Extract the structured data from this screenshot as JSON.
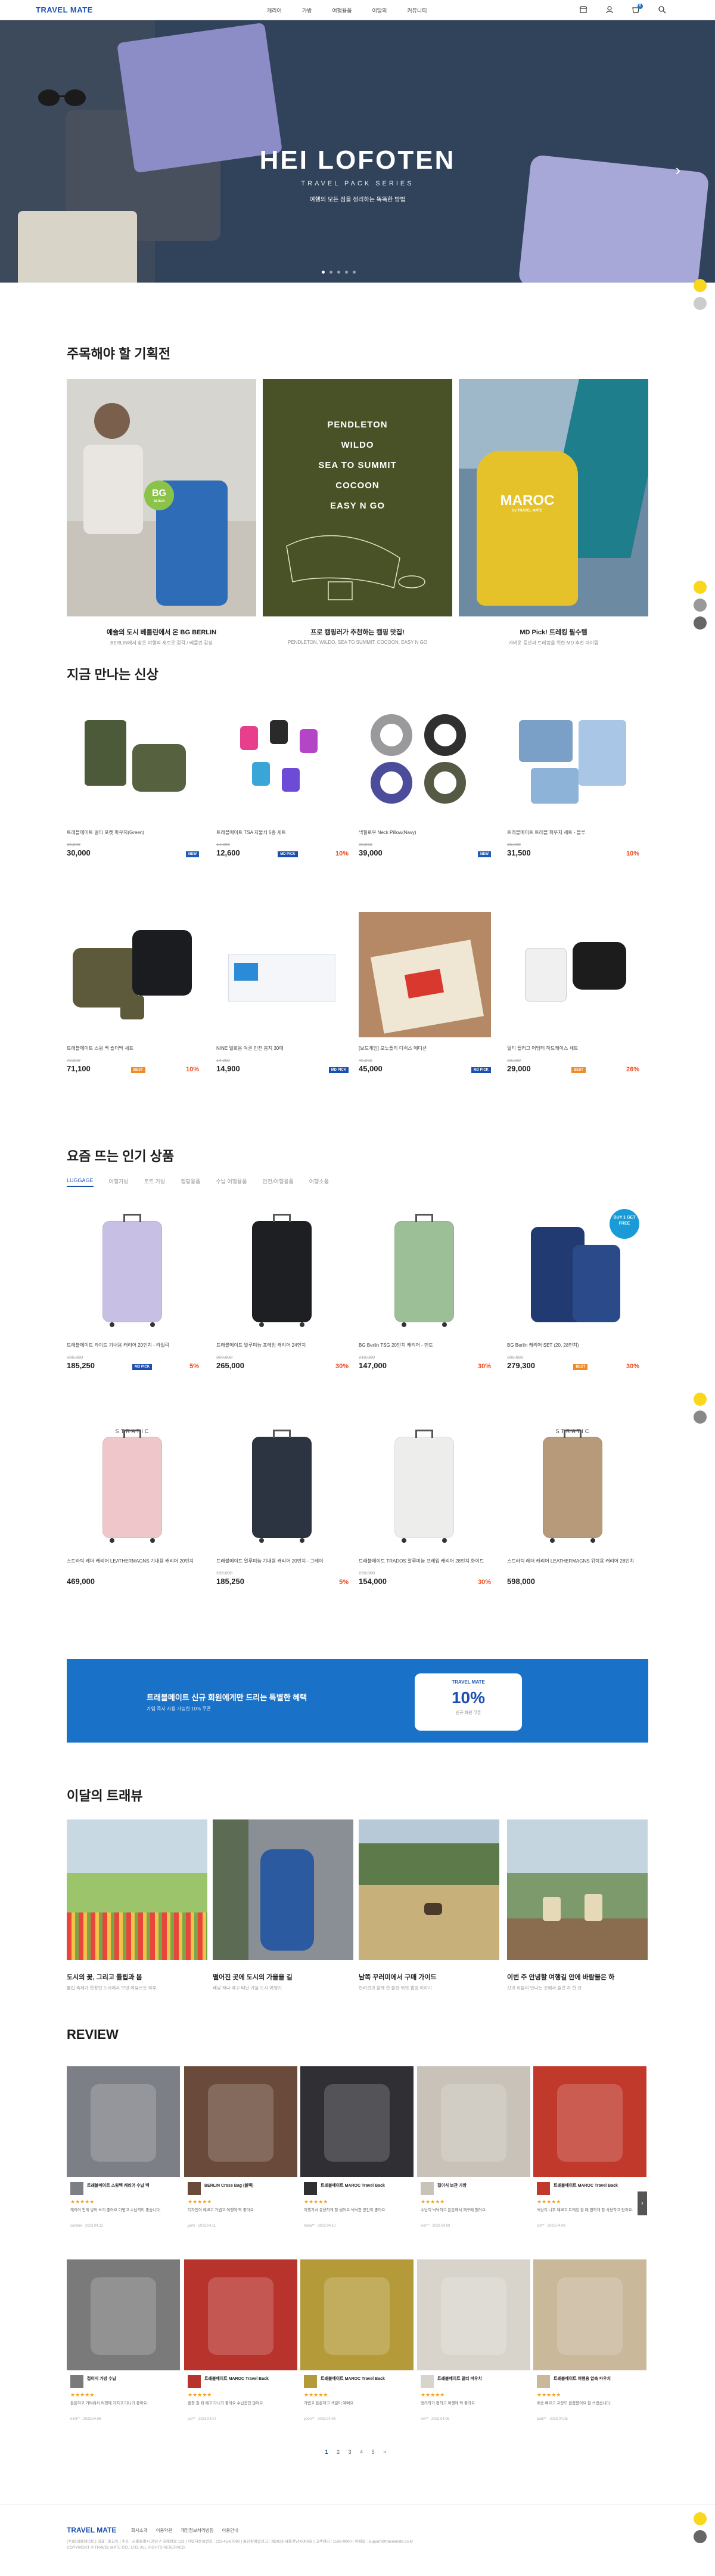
{
  "header": {
    "logo": "TRAVEL MATE",
    "nav": [
      "캐리어",
      "가방",
      "여행용품",
      "이달의",
      "커뮤니티"
    ],
    "cart_count": "0"
  },
  "hero": {
    "title": "HEI LOFOTEN",
    "subtitle": "TRAVEL PACK SERIES",
    "desc": "여행의 모든 짐을 정리하는 똑똑한 방법",
    "slide_count": 5,
    "active_slide": 1
  },
  "promo": {
    "title": "주목해야 할 기획전",
    "items": [
      {
        "title": "예술의 도시 베를린에서 온 BG BERLIN",
        "desc": "BERLIN에서 찾은 여행의 새로운 감각 / 베를린 감성",
        "logo": "BG",
        "logo_sub": "BERLIN"
      },
      {
        "title": "프로 캠핑러가 추천하는 캠핑 맛집!",
        "desc": "PENDLETON, WILDO, SEA TO SUMMIT, COCOON, EASY N GO",
        "brands": [
          "PENDLETON",
          "WILDO",
          "SEA TO SUMMIT",
          "COCOON",
          "EASY N GO"
        ]
      },
      {
        "title": "MD Pick! 트레킹 필수템",
        "desc": "가벼운 등산과 트레킹을 위한 MD 추천 아이템",
        "logo": "MAROC",
        "logo_sub": "by TRAVEL MATE"
      }
    ]
  },
  "new_arrivals": {
    "title": "지금 만나는 신상",
    "items": [
      {
        "name": "트래블메이트 멀티 포켓 파우치(Green)",
        "orig": "35,000",
        "price": "30,000",
        "badge": "NEW",
        "disc": ""
      },
      {
        "name": "트래블메이트 TSA 자물쇠 5종 세트",
        "orig": "14,000",
        "price": "12,600",
        "badge": "MD PICK",
        "disc": "10%"
      },
      {
        "name": "넥필로우 Neck Pillow(Navy)",
        "orig": "39,000",
        "price": "39,000",
        "badge": "NEW",
        "disc": ""
      },
      {
        "name": "트래블메이트 트래블 파우치 세트 - 블루",
        "orig": "35,000",
        "price": "31,500",
        "badge": "",
        "disc": "10%"
      },
      {
        "name": "트래블메이트 스윙 백 숄더백 세트",
        "orig": "79,000",
        "price": "71,100",
        "badge": "BEST",
        "disc": "10%"
      },
      {
        "name": "NINE 일회용 여권 안전 봉지 30매",
        "orig": "14,900",
        "price": "14,900",
        "badge": "MD PICK",
        "disc": ""
      },
      {
        "name": "[보드게임] 모노폴리 디럭스 에디션",
        "orig": "45,000",
        "price": "45,000",
        "badge": "MD PICK",
        "disc": ""
      },
      {
        "name": "멀티 플러그 어댑터 하드케이스 세트",
        "orig": "39,000",
        "price": "29,000",
        "badge": "BEST",
        "disc": "26%"
      }
    ]
  },
  "popular": {
    "title": "요즘 뜨는 인기 상품",
    "tabs": [
      "LUGGAGE",
      "여행가방",
      "토트 가방",
      "캠핑용품",
      "수납 여행용품",
      "안전/여행용품",
      "여행소품"
    ],
    "items": [
      {
        "name": "트래블메이트 라이트 기내용 캐리어 20인치 - 라일락",
        "orig": "195,000",
        "price": "185,250",
        "badge": "MD PICK",
        "disc": "5%"
      },
      {
        "name": "트래블메이트 알루미늄 프레임 캐리어 24인치",
        "orig": "390,000",
        "price": "265,000",
        "badge": "",
        "disc": "30%"
      },
      {
        "name": "BG Berlin TSG 20인치 캐리어 - 민트",
        "orig": "210,000",
        "price": "147,000",
        "badge": "",
        "disc": "30%"
      },
      {
        "name": "BG Berlin 캐리어 SET (20, 28인치)",
        "orig": "399,000",
        "price": "279,300",
        "badge": "BEST",
        "disc": "30%",
        "promo_tag": "BUY 1 GET FREE"
      },
      {
        "name": "스트라틱 레더 캐리어 LEATHERMAGNS 기내용 캐리어 20인치",
        "orig": "",
        "price": "469,000",
        "badge": "",
        "disc": "",
        "brand": "STRATIC"
      },
      {
        "name": "트래블메이트 알루미늄 기내용 캐리어 20인치 - 그레이",
        "orig": "195,000",
        "price": "185,250",
        "badge": "",
        "disc": "5%"
      },
      {
        "name": "트래블메이트 TRADOS 알루미늄 프레임 캐리어 28인치 화이트",
        "orig": "220,000",
        "price": "154,000",
        "badge": "",
        "disc": "30%"
      },
      {
        "name": "스트라틱 레더 캐리어 LEATHERMAGNS 위탁용 캐리어 28인치",
        "orig": "",
        "price": "598,000",
        "badge": "",
        "disc": "",
        "brand": "STRATIC"
      }
    ]
  },
  "banner": {
    "title": "트래블메이트 신규 회원에게만 드리는 특별한 혜택",
    "desc": "가입 즉시 사용 가능한 10% 쿠폰",
    "coupon_brand": "TRAVEL MATE",
    "coupon_value": "10%",
    "coupon_desc": "신규 회원 쿠폰"
  },
  "travel_reviews": {
    "title": "이달의 트래뷰",
    "items": [
      {
        "title": "도시의 꽃, 그리고 튤립과 봄",
        "desc": "튤립 축제가 한창인 도시에서 보낸 여유로운 하루"
      },
      {
        "title": "떨어진 곳에 도시의 가을을 길",
        "desc": "배낭 하나 메고 떠난 가을 도시 여행기"
      },
      {
        "title": "남쪽 꾸러미에서 구매 가이드",
        "desc": "반려견과 함께 한 들판 위의 캠핑 이야기"
      },
      {
        "title": "이번 주 안녕할 여행길 안에 바람불은 하",
        "desc": "산과 하늘이 만나는 곳에서 즐긴 차 한 잔"
      }
    ]
  },
  "reviews": {
    "title": "REVIEW",
    "items": [
      {
        "product": "트래블메이트 스윙백 캐리어 수납 백",
        "stars": "★★★★★",
        "text": "캐리어 안에 넣어 쓰기 좋아요 가볍고 수납력이 좋습니다.",
        "meta": "sonnne · 2023.04.12"
      },
      {
        "product": "BERLIN Cross Bag (블랙)",
        "stars": "★★★★★",
        "text": "디자인이 예쁘고 가볍고 여행에 딱 좋아요.",
        "meta": "jjami · 2023.04.11"
      },
      {
        "product": "트래블메이트 MAROC Travel Back",
        "stars": "★★★★★",
        "text": "여행가서 유용하게 잘 썼어요 넉넉한 공간이 좋아요.",
        "meta": "hana** · 2023.04.10"
      },
      {
        "product": "접이식 보관 가방",
        "stars": "★★★★★",
        "text": "수납이 넉넉하고 튼튼해서 재구매 했어요.",
        "meta": "kim** · 2023.04.09"
      },
      {
        "product": "트래블메이트 MAROC Travel Back",
        "stars": "★★★★★",
        "text": "색상이 너무 예쁘고 트레킹 할 때 편하게 잘 사용하고 있어요.",
        "meta": "sol** · 2023.04.08"
      },
      {
        "product": "접이식 가방 수납",
        "stars": "★★★★★",
        "text": "튼튼하고 가벼워서 여행에 가지고 다니기 좋아요.",
        "meta": "mint** · 2023.04.08"
      },
      {
        "product": "트래블메이트 MAROC Travel Back",
        "stars": "★★★★★",
        "text": "캠핑 갈 때 메고 다니기 좋아요 수납공간 많아요.",
        "meta": "joo** · 2023.04.07"
      },
      {
        "product": "트래블메이트 MAROC Travel Back",
        "stars": "★★★★★",
        "text": "가볍고 튼튼하고 색감이 예뻐요.",
        "meta": "yoon** · 2023.04.06"
      },
      {
        "product": "트래블메이트 멀티 파우치",
        "stars": "★★★★★",
        "text": "정리하기 편하고 여행에 딱 좋아요.",
        "meta": "lee** · 2023.04.05"
      },
      {
        "product": "트래블메이트 여행용 압축 파우치",
        "stars": "★★★★★",
        "text": "배송 빠르고 포장도 꼼꼼했어요 잘 쓰겠습니다.",
        "meta": "park** · 2023.04.05"
      }
    ],
    "pager": [
      "1",
      "2",
      "3",
      "4",
      "5",
      ">"
    ]
  },
  "footer": {
    "logo": "TRAVEL MATE",
    "menu": [
      "회사소개",
      "이용약관",
      "개인정보처리방침",
      "이용안내"
    ],
    "info": "(주)트래블메이트 | 대표 : 홍길동 | 주소 : 서울특별시 강남구 테헤란로 123 | 사업자등록번호 : 123-45-67890 | 통신판매업신고 : 제2023-서울강남-0000호 | 고객센터 : 1588-0000 | 이메일 : support@travelmate.co.kr",
    "copy": "COPYRIGHT © TRAVEL MATE CO., LTD. ALL RIGHTS RESERVED."
  },
  "colors": {
    "brand": "#1a4fb0",
    "accent": "#f04b23",
    "banner": "#1a72c8"
  }
}
